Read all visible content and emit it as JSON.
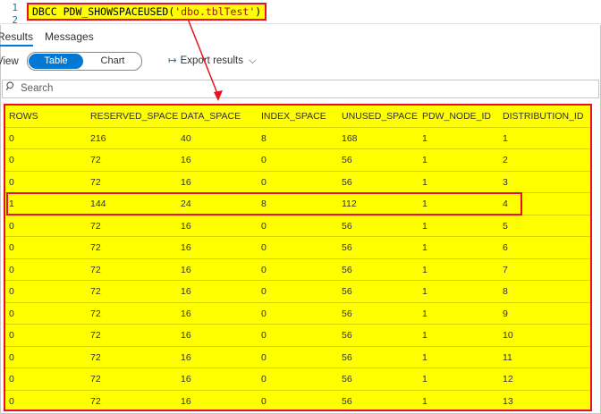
{
  "editor": {
    "line_numbers": [
      "1",
      "2"
    ],
    "code_keyword": "DBCC PDW_SHOWSPACEUSED(",
    "code_string": "'dbo.tblTest'",
    "code_close": ")"
  },
  "tabs": {
    "results": "Results",
    "messages": "Messages"
  },
  "view_bar": {
    "view_label": "View",
    "table_label": "Table",
    "chart_label": "Chart",
    "export_label": "Export results",
    "export_icon": "export-arrow-icon",
    "chevron_icon": "chevron-down-icon"
  },
  "search": {
    "placeholder": "Search",
    "icon": "search-icon"
  },
  "colors": {
    "highlight": "#ffff00",
    "annotation": "#e81123",
    "accent": "#0078d4"
  },
  "grid": {
    "columns": [
      "ROWS",
      "RESERVED_SPACE",
      "DATA_SPACE",
      "INDEX_SPACE",
      "UNUSED_SPACE",
      "PDW_NODE_ID",
      "DISTRIBUTION_ID"
    ],
    "rows": [
      [
        "0",
        "216",
        "40",
        "8",
        "168",
        "1",
        "1"
      ],
      [
        "0",
        "72",
        "16",
        "0",
        "56",
        "1",
        "2"
      ],
      [
        "0",
        "72",
        "16",
        "0",
        "56",
        "1",
        "3"
      ],
      [
        "1",
        "144",
        "24",
        "8",
        "112",
        "1",
        "4"
      ],
      [
        "0",
        "72",
        "16",
        "0",
        "56",
        "1",
        "5"
      ],
      [
        "0",
        "72",
        "16",
        "0",
        "56",
        "1",
        "6"
      ],
      [
        "0",
        "72",
        "16",
        "0",
        "56",
        "1",
        "7"
      ],
      [
        "0",
        "72",
        "16",
        "0",
        "56",
        "1",
        "8"
      ],
      [
        "0",
        "72",
        "16",
        "0",
        "56",
        "1",
        "9"
      ],
      [
        "0",
        "72",
        "16",
        "0",
        "56",
        "1",
        "10"
      ],
      [
        "0",
        "72",
        "16",
        "0",
        "56",
        "1",
        "11"
      ],
      [
        "0",
        "72",
        "16",
        "0",
        "56",
        "1",
        "12"
      ],
      [
        "0",
        "72",
        "16",
        "0",
        "56",
        "1",
        "13"
      ]
    ],
    "highlighted_row_index": 3
  }
}
